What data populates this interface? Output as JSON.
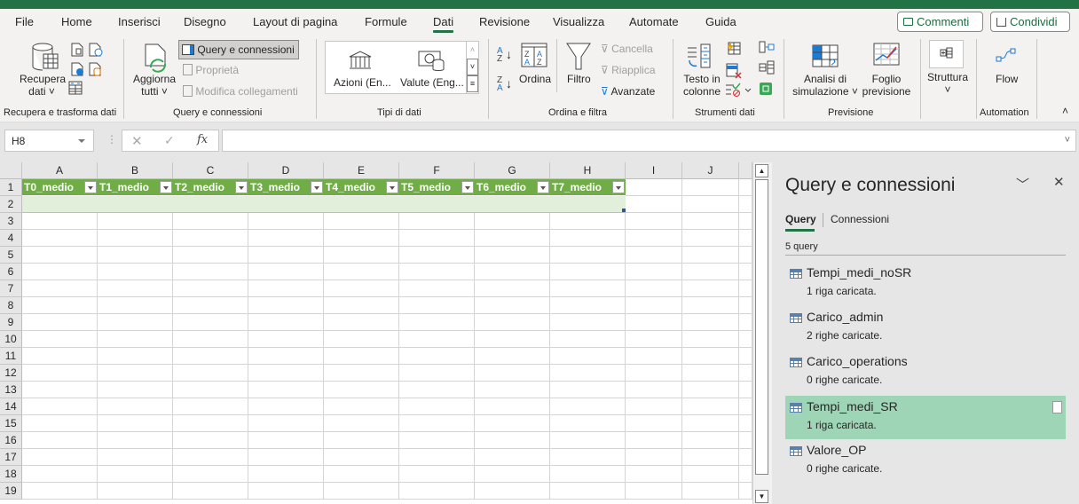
{
  "menu": {
    "tabs": [
      "File",
      "Home",
      "Inserisci",
      "Disegno",
      "Layout di pagina",
      "Formule",
      "Dati",
      "Revisione",
      "Visualizza",
      "Automate",
      "Guida"
    ],
    "active_tab": "Dati",
    "comments_label": "Commenti",
    "share_label": "Condividi"
  },
  "ribbon": {
    "groups": {
      "get_transform": {
        "label": "Recupera e trasforma dati",
        "get_data": "Recupera",
        "get_data_2": "dati"
      },
      "queries": {
        "label": "Query e connessioni",
        "refresh_all": "Aggiorna",
        "refresh_all_2": "tutti",
        "queries_connections": "Query e connessioni",
        "properties": "Proprietà",
        "edit_links": "Modifica collegamenti"
      },
      "data_types": {
        "label": "Tipi di dati",
        "stocks": "Azioni (En...",
        "currencies": "Valute (Eng..."
      },
      "sort_filter": {
        "label": "Ordina e filtra",
        "sort": "Ordina",
        "filter": "Filtro",
        "clear": "Cancella",
        "reapply": "Riapplica",
        "advanced": "Avanzate"
      },
      "data_tools": {
        "label": "Strumenti dati",
        "text_to_columns": "Testo in",
        "text_to_columns_2": "colonne"
      },
      "forecast": {
        "label": "Previsione",
        "what_if": "Analisi di",
        "what_if_2": "simulazione",
        "forecast_sheet": "Foglio",
        "forecast_sheet_2": "previsione"
      },
      "outline": {
        "label": "",
        "structure": "Struttura"
      },
      "automation": {
        "label": "Automation",
        "flow": "Flow"
      }
    }
  },
  "formula_bar": {
    "name_box": "H8",
    "fx_label": "fx",
    "formula": ""
  },
  "sheet": {
    "columns": [
      "A",
      "B",
      "C",
      "D",
      "E",
      "F",
      "G",
      "H",
      "I",
      "J"
    ],
    "rows": [
      "1",
      "2",
      "3",
      "4",
      "5",
      "6",
      "7",
      "8",
      "9",
      "10",
      "11",
      "12",
      "13",
      "14",
      "15",
      "16",
      "17",
      "18",
      "19"
    ],
    "table_headers": [
      "T0_medio",
      "T1_medio",
      "T2_medio",
      "T3_medio",
      "T4_medio",
      "T5_medio",
      "T6_medio",
      "T7_medio"
    ],
    "table_header_color": "#70ad47",
    "table_row_color": "#e2efda"
  },
  "pane": {
    "title": "Query e connessioni",
    "tabs": [
      "Query",
      "Connessioni"
    ],
    "active_tab": "Query",
    "count": "5 query",
    "queries": [
      {
        "name": "Tempi_medi_noSR",
        "status": "1 riga caricata.",
        "selected": false
      },
      {
        "name": "Carico_admin",
        "status": "2 righe caricate.",
        "selected": false
      },
      {
        "name": "Carico_operations",
        "status": "0 righe caricate.",
        "selected": false
      },
      {
        "name": "Tempi_medi_SR",
        "status": "1 riga caricata.",
        "selected": true
      },
      {
        "name": "Valore_OP",
        "status": "0 righe caricate.",
        "selected": false
      }
    ]
  }
}
